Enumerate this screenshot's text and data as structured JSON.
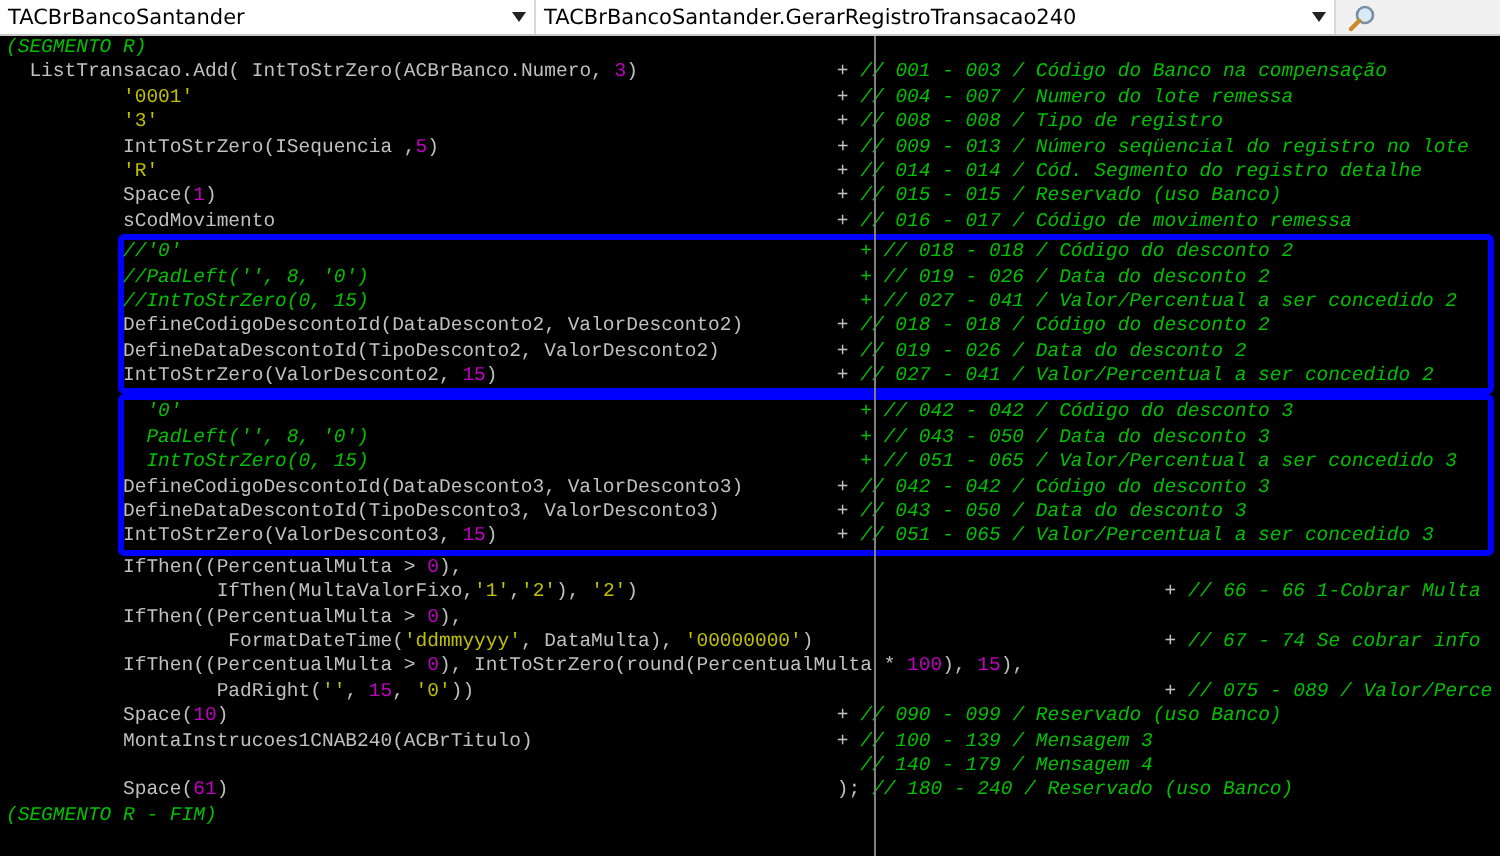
{
  "toolbar": {
    "class_dropdown": "TACBrBancoSantander",
    "method_dropdown": "TACBrBancoSantander.GerarRegistroTransacao240"
  },
  "editor": {
    "blocks": [
      {
        "highlighted": false,
        "lines": [
          [
            {
              "kind": "comment",
              "text": "(SEGMENTO R)"
            }
          ],
          [
            {
              "kind": "code",
              "text": "  ListTransacao.Add( IntToStrZero(ACBrBanco.Numero, "
            },
            {
              "kind": "number",
              "text": "3"
            },
            {
              "kind": "code",
              "text": ")                 + "
            },
            {
              "kind": "comment",
              "text": "// 001 - 003 / Código do Banco na compensação"
            }
          ],
          [
            {
              "kind": "string",
              "text": "          '0001'"
            },
            {
              "kind": "code",
              "text": "                                                       + "
            },
            {
              "kind": "comment",
              "text": "// 004 - 007 / Numero do lote remessa"
            }
          ],
          [
            {
              "kind": "string",
              "text": "          '3'"
            },
            {
              "kind": "code",
              "text": "                                                          + "
            },
            {
              "kind": "comment",
              "text": "// 008 - 008 / Tipo de registro"
            }
          ],
          [
            {
              "kind": "code",
              "text": "          IntToStrZero(ISequencia ,"
            },
            {
              "kind": "number",
              "text": "5"
            },
            {
              "kind": "code",
              "text": ")                                  + "
            },
            {
              "kind": "comment",
              "text": "// 009 - 013 / Número seqüencial do registro no lote"
            }
          ],
          [
            {
              "kind": "string",
              "text": "          'R'"
            },
            {
              "kind": "code",
              "text": "                                                          + "
            },
            {
              "kind": "comment",
              "text": "// 014 - 014 / Cód. Segmento do registro detalhe"
            }
          ],
          [
            {
              "kind": "code",
              "text": "          Space("
            },
            {
              "kind": "number",
              "text": "1"
            },
            {
              "kind": "code",
              "text": ")                                                     + "
            },
            {
              "kind": "comment",
              "text": "// 015 - 015 / Reservado (uso Banco)"
            }
          ],
          [
            {
              "kind": "code",
              "text": "          sCodMovimento                                                + "
            },
            {
              "kind": "comment",
              "text": "// 016 - 017 / Código de movimento remessa"
            }
          ]
        ]
      },
      {
        "highlighted": true,
        "lines": [
          [
            {
              "kind": "comment",
              "text": "//'0'                                                          + // 018 - 018 / Código do desconto 2"
            }
          ],
          [
            {
              "kind": "comment",
              "text": "//PadLeft('', 8, '0')                                          + // 019 - 026 / Data do desconto 2"
            }
          ],
          [
            {
              "kind": "comment",
              "text": "//IntToStrZero(0, 15)                                          + // 027 - 041 / Valor/Percentual a ser concedido 2"
            }
          ],
          [
            {
              "kind": "code",
              "text": "DefineCodigoDescontoId(DataDesconto2, ValorDesconto2)        + "
            },
            {
              "kind": "comment",
              "text": "// 018 - 018 / Código do desconto 2"
            }
          ],
          [
            {
              "kind": "code",
              "text": "DefineDataDescontoId(TipoDesconto2, ValorDesconto2)          + "
            },
            {
              "kind": "comment",
              "text": "// 019 - 026 / Data do desconto 2"
            }
          ],
          [
            {
              "kind": "code",
              "text": "IntToStrZero(ValorDesconto2, "
            },
            {
              "kind": "number",
              "text": "15"
            },
            {
              "kind": "code",
              "text": ")                             + "
            },
            {
              "kind": "comment",
              "text": "// 027 - 041 / Valor/Percentual a ser concedido 2"
            }
          ]
        ]
      },
      {
        "highlighted": true,
        "lines": [
          [
            {
              "kind": "comment",
              "text": "  '0'                                                          + // 042 - 042 / Código do desconto 3"
            }
          ],
          [
            {
              "kind": "comment",
              "text": "  PadLeft('', 8, '0')                                          + // 043 - 050 / Data do desconto 3"
            }
          ],
          [
            {
              "kind": "comment",
              "text": "  IntToStrZero(0, 15)                                          + // 051 - 065 / Valor/Percentual a ser concedido 3"
            }
          ],
          [
            {
              "kind": "code",
              "text": "DefineCodigoDescontoId(DataDesconto3, ValorDesconto3)        + "
            },
            {
              "kind": "comment",
              "text": "// 042 - 042 / Código do desconto 3"
            }
          ],
          [
            {
              "kind": "code",
              "text": "DefineDataDescontoId(TipoDesconto3, ValorDesconto3)          + "
            },
            {
              "kind": "comment",
              "text": "// 043 - 050 / Data do desconto 3"
            }
          ],
          [
            {
              "kind": "code",
              "text": "IntToStrZero(ValorDesconto3, "
            },
            {
              "kind": "number",
              "text": "15"
            },
            {
              "kind": "code",
              "text": ")                             + "
            },
            {
              "kind": "comment",
              "text": "// 051 - 065 / Valor/Percentual a ser concedido 3"
            }
          ]
        ]
      },
      {
        "highlighted": false,
        "lines": [
          [
            {
              "kind": "code",
              "text": "          IfThen((PercentualMulta > "
            },
            {
              "kind": "number",
              "text": "0"
            },
            {
              "kind": "code",
              "text": "),"
            }
          ],
          [
            {
              "kind": "code",
              "text": "                  IfThen(MultaValorFixo,"
            },
            {
              "kind": "string",
              "text": "'1'"
            },
            {
              "kind": "code",
              "text": ","
            },
            {
              "kind": "string",
              "text": "'2'"
            },
            {
              "kind": "code",
              "text": "), "
            },
            {
              "kind": "string",
              "text": "'2'"
            },
            {
              "kind": "code",
              "text": ")                                             + "
            },
            {
              "kind": "comment",
              "text": "// 66 - 66 1-Cobrar Multa"
            }
          ],
          [
            {
              "kind": "code",
              "text": "          IfThen((PercentualMulta > "
            },
            {
              "kind": "number",
              "text": "0"
            },
            {
              "kind": "code",
              "text": "),"
            }
          ],
          [
            {
              "kind": "code",
              "text": "                   FormatDateTime("
            },
            {
              "kind": "string",
              "text": "'ddmmyyyy'"
            },
            {
              "kind": "code",
              "text": ", DataMulta), "
            },
            {
              "kind": "string",
              "text": "'00000000'"
            },
            {
              "kind": "code",
              "text": ")                              + "
            },
            {
              "kind": "comment",
              "text": "// 67 - 74 Se cobrar info"
            }
          ],
          [
            {
              "kind": "code",
              "text": "          IfThen((PercentualMulta > "
            },
            {
              "kind": "number",
              "text": "0"
            },
            {
              "kind": "code",
              "text": "), IntToStrZero(round(PercentualMulta * "
            },
            {
              "kind": "number",
              "text": "100"
            },
            {
              "kind": "code",
              "text": "), "
            },
            {
              "kind": "number",
              "text": "15"
            },
            {
              "kind": "code",
              "text": "),"
            }
          ],
          [
            {
              "kind": "code",
              "text": "                  PadRight("
            },
            {
              "kind": "string",
              "text": "''"
            },
            {
              "kind": "code",
              "text": ", "
            },
            {
              "kind": "number",
              "text": "15"
            },
            {
              "kind": "code",
              "text": ", "
            },
            {
              "kind": "string",
              "text": "'0'"
            },
            {
              "kind": "code",
              "text": "))                                                           + "
            },
            {
              "kind": "comment",
              "text": "// 075 - 089 / Valor/Perce"
            }
          ],
          [
            {
              "kind": "code",
              "text": "          Space("
            },
            {
              "kind": "number",
              "text": "10"
            },
            {
              "kind": "code",
              "text": ")                                                    + "
            },
            {
              "kind": "comment",
              "text": "// 090 - 099 / Reservado (uso Banco)"
            }
          ],
          [
            {
              "kind": "code",
              "text": "          MontaInstrucoes1CNAB240(ACBrTitulo)                          + "
            },
            {
              "kind": "comment",
              "text": "// 100 - 139 / Mensagem 3"
            }
          ],
          [
            {
              "kind": "comment",
              "text": "                                                                         // 140 - 179 / Mensagem 4"
            }
          ],
          [
            {
              "kind": "code",
              "text": "          Space("
            },
            {
              "kind": "number",
              "text": "61"
            },
            {
              "kind": "code",
              "text": ")                                                    ); "
            },
            {
              "kind": "comment",
              "text": "// 180 - 240 / Reservado (uso Banco)"
            }
          ],
          [
            {
              "kind": "comment",
              "text": "(SEGMENTO R - FIM)"
            }
          ]
        ]
      }
    ]
  }
}
